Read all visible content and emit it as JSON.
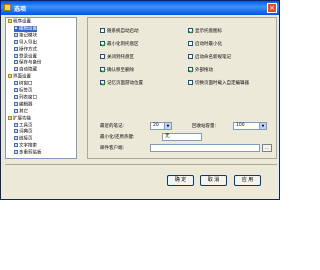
{
  "window": {
    "title": "选项"
  },
  "tree": [
    {
      "label": "程序设置",
      "type": "grp"
    },
    {
      "label": "编辑设置",
      "type": "leaf"
    },
    {
      "label": "笔记模块",
      "type": "leaf"
    },
    {
      "label": "导入导出",
      "type": "leaf"
    },
    {
      "label": "操作方式",
      "type": "leaf"
    },
    {
      "label": "登录设置",
      "type": "leaf"
    },
    {
      "label": "保存与备份",
      "type": "leaf"
    },
    {
      "label": "自动隐藏",
      "type": "leaf"
    },
    {
      "label": "界面设置",
      "type": "grp"
    },
    {
      "label": "树窗口",
      "type": "leaf"
    },
    {
      "label": "标签页",
      "type": "leaf"
    },
    {
      "label": "列表窗口",
      "type": "leaf"
    },
    {
      "label": "编辑器",
      "type": "leaf"
    },
    {
      "label": "其它",
      "type": "leaf"
    },
    {
      "label": "扩展功能",
      "type": "grp"
    },
    {
      "label": "工具页",
      "type": "leaf"
    },
    {
      "label": "词典页",
      "type": "leaf"
    },
    {
      "label": "链接页",
      "type": "leaf"
    },
    {
      "label": "文字搜索",
      "type": "leaf"
    },
    {
      "label": "多重剪贴板",
      "type": "leaf"
    }
  ],
  "tree_selected_index": 1,
  "options": {
    "checkboxes": [
      {
        "label": "随系统自动启动",
        "checked": false
      },
      {
        "label": "显示托盘图标",
        "checked": true
      },
      {
        "label": "最小化到托盘区",
        "checked": true
      },
      {
        "label": "启动时最小化",
        "checked": false
      },
      {
        "label": "关闭到托盘区",
        "checked": false
      },
      {
        "label": "启动命名新规笔记",
        "checked": false
      },
      {
        "label": "确认移至删除",
        "checked": true
      },
      {
        "label": "外部拖动",
        "checked": true
      },
      {
        "label": "记忆页面游动位置",
        "checked": true
      },
      {
        "label": "切换页面时载入自定编辑器",
        "checked": false
      }
    ],
    "recent_notes_label": "最近的笔记:",
    "recent_notes_value": "20",
    "recycle_label": "回收站容量:",
    "recycle_value": "100",
    "minimize_label": "最小化/还原热键:",
    "minimize_value": "无",
    "mail_label": "邮件客户端:",
    "mail_value": "",
    "browse_label": "..."
  },
  "buttons": {
    "ok": "确 定",
    "cancel": "取 消",
    "apply": "应 用"
  },
  "icons": {
    "close": "close-icon",
    "app": "app-icon"
  }
}
